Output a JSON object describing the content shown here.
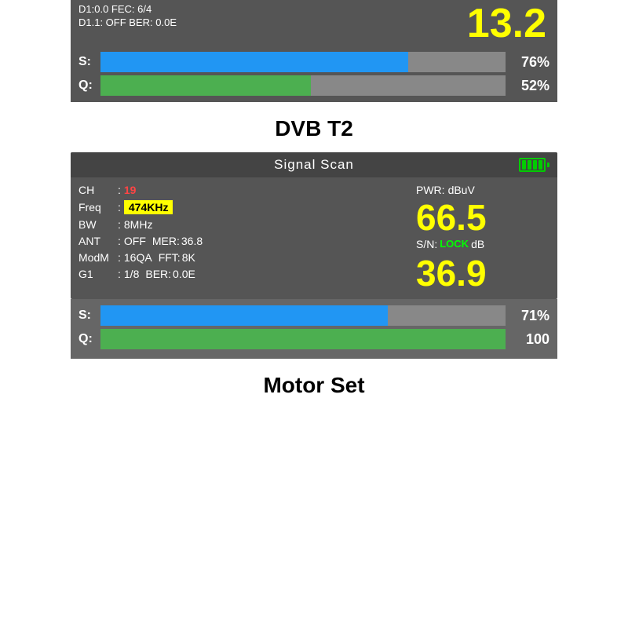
{
  "top_partial": {
    "row1": "D1:0.0   FEC:  6/4",
    "row2": "D1.1: OFF  BER:  0.0E",
    "big_number": "13.2"
  },
  "top_bars": {
    "s_label": "S:",
    "s_pct": "76%",
    "s_fill": 76,
    "q_label": "Q:",
    "q_pct": "52%",
    "q_fill": 52
  },
  "dvb_title": "DVB  T2",
  "signal_panel": {
    "header": {
      "signal_text": "Signal   Scan",
      "battery_bars": 4
    },
    "left": {
      "ch_label": "CH",
      "ch_val": "19",
      "freq_label": "Freq",
      "freq_val": "474KHz",
      "bw_label": "BW",
      "bw_val": "8MHz",
      "ant_label": "ANT",
      "ant_val": "OFF",
      "mer_label": "MER:",
      "mer_val": "36.8",
      "modm_label": "ModM",
      "modm_val": "16QA",
      "fft_label": "FFT:",
      "fft_val": "8K",
      "g1_label": "G1",
      "g1_val": "1/8",
      "ber_label": "BER:",
      "ber_val": "0.0E"
    },
    "right": {
      "pwr_label": "PWR:",
      "pwr_unit": "dBuV",
      "big_val1": "66.5",
      "sn_label": "S/N:",
      "lock_text": "LOCK",
      "sn_unit": "dB",
      "big_val2": "36.9"
    }
  },
  "bottom_bars": {
    "s_label": "S:",
    "s_pct": "71%",
    "s_fill": 71,
    "q_label": "Q:",
    "q_pct": "100",
    "q_fill": 100
  },
  "motor_title": "Motor  Set"
}
